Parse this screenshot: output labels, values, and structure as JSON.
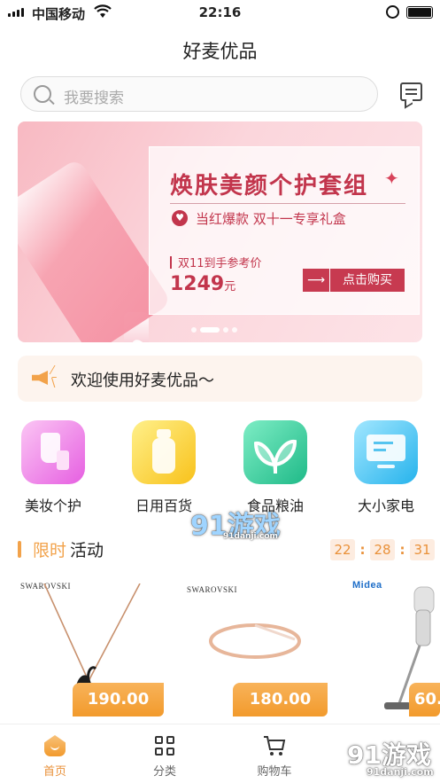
{
  "status": {
    "carrier": "中国移动",
    "time": "22:16"
  },
  "header": {
    "title": "好麦优品"
  },
  "search": {
    "placeholder": "我要搜索"
  },
  "banner": {
    "headline": "焕肤美颜个护套组",
    "subline": "当红爆款 双十一专享礼盒",
    "ref_label": "双11到手参考价",
    "price": "1249",
    "currency": "元",
    "buy_label": "点击购买"
  },
  "notice": {
    "text": "欢迎使用好麦优品～"
  },
  "categories": [
    {
      "label": "美妆个护",
      "icon": "cosmetics-icon",
      "color": "#e65fe1"
    },
    {
      "label": "日用百货",
      "icon": "bottle-icon",
      "color": "#f8c21b"
    },
    {
      "label": "食品粮油",
      "icon": "leaf-icon",
      "color": "#1fba88"
    },
    {
      "label": "大小家电",
      "icon": "monitor-icon",
      "color": "#26b3ec"
    }
  ],
  "flash": {
    "title_highlight": "限时",
    "title_rest": "活动",
    "countdown": {
      "h": "22",
      "m": "28",
      "s": "31"
    }
  },
  "products": [
    {
      "brand": "SWAROVSKI",
      "price": "190.00"
    },
    {
      "brand": "SWAROVSKI",
      "price": "180.00"
    },
    {
      "brand": "Midea",
      "price": "60."
    }
  ],
  "tabs": [
    {
      "label": "首页",
      "active": true
    },
    {
      "label": "分类",
      "active": false
    },
    {
      "label": "购物车",
      "active": false
    }
  ],
  "watermarks": {
    "center": "91游戏",
    "center_sub": "91danji.com",
    "corner": "91游戏",
    "corner_sub": "91danji.com"
  },
  "colors": {
    "accent": "#f2a24a",
    "banner_red": "#c2354c"
  }
}
